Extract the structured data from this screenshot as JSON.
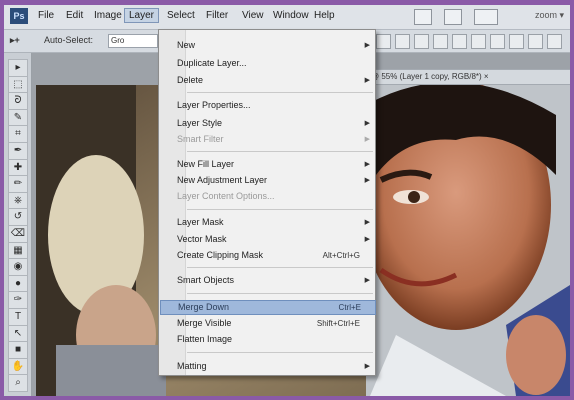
{
  "menubar": {
    "logo_text": "Ps",
    "items": [
      "File",
      "Edit",
      "Image",
      "Layer",
      "Select",
      "Filter",
      "View",
      "Window",
      "Help"
    ],
    "right_text": "zoom ▾"
  },
  "options_bar": {
    "tool_glyph": "▸+",
    "auto_select_label": "Auto-Select:",
    "auto_select_value": "Gro"
  },
  "document": {
    "tab_title": "@ 55% (Layer 1 copy, RGB/8*) ×"
  },
  "layer_menu": {
    "items": [
      {
        "label": "New",
        "shortcut": "",
        "submenu": true,
        "enabled": true
      },
      {
        "label": "Duplicate Layer...",
        "shortcut": "",
        "submenu": false,
        "enabled": true
      },
      {
        "label": "Delete",
        "shortcut": "",
        "submenu": true,
        "enabled": true
      },
      {
        "label": "Layer Properties...",
        "shortcut": "",
        "submenu": false,
        "enabled": true
      },
      {
        "label": "Layer Style",
        "shortcut": "",
        "submenu": true,
        "enabled": true
      },
      {
        "label": "Smart Filter",
        "shortcut": "",
        "submenu": true,
        "enabled": false
      },
      {
        "label": "New Fill Layer",
        "shortcut": "",
        "submenu": true,
        "enabled": true
      },
      {
        "label": "New Adjustment Layer",
        "shortcut": "",
        "submenu": true,
        "enabled": true
      },
      {
        "label": "Layer Content Options...",
        "shortcut": "",
        "submenu": false,
        "enabled": false
      },
      {
        "label": "Layer Mask",
        "shortcut": "",
        "submenu": true,
        "enabled": true
      },
      {
        "label": "Vector Mask",
        "shortcut": "",
        "submenu": true,
        "enabled": true
      },
      {
        "label": "Create Clipping Mask",
        "shortcut": "Alt+Ctrl+G",
        "submenu": false,
        "enabled": true
      },
      {
        "label": "Smart Objects",
        "shortcut": "",
        "submenu": true,
        "enabled": true
      },
      {
        "label": "Merge Down",
        "shortcut": "Ctrl+E",
        "submenu": false,
        "enabled": true,
        "highlighted": true
      },
      {
        "label": "Merge Visible",
        "shortcut": "Shift+Ctrl+E",
        "submenu": false,
        "enabled": true
      },
      {
        "label": "Flatten Image",
        "shortcut": "",
        "submenu": false,
        "enabled": true
      },
      {
        "label": "Matting",
        "shortcut": "",
        "submenu": true,
        "enabled": true
      }
    ]
  },
  "toolbox": {
    "tools": [
      "move-tool",
      "marquee-tool",
      "lasso-tool",
      "quick-select-tool",
      "crop-tool",
      "eyedropper-tool",
      "healing-brush-tool",
      "brush-tool",
      "clone-stamp-tool",
      "history-brush-tool",
      "eraser-tool",
      "gradient-tool",
      "blur-tool",
      "dodge-tool",
      "pen-tool",
      "type-tool",
      "path-select-tool",
      "shape-tool",
      "hand-tool",
      "zoom-tool"
    ],
    "glyphs": [
      "▸",
      "⬚",
      "ᘐ",
      "✎",
      "⌗",
      "✒",
      "✚",
      "✏",
      "⎈",
      "↺",
      "⌫",
      "▦",
      "◉",
      "●",
      "✑",
      "T",
      "↖",
      "■",
      "✋",
      "⌕"
    ]
  },
  "colors": {
    "accent_highlight": "#9fb8db",
    "frame_border": "#8a5aa7"
  }
}
